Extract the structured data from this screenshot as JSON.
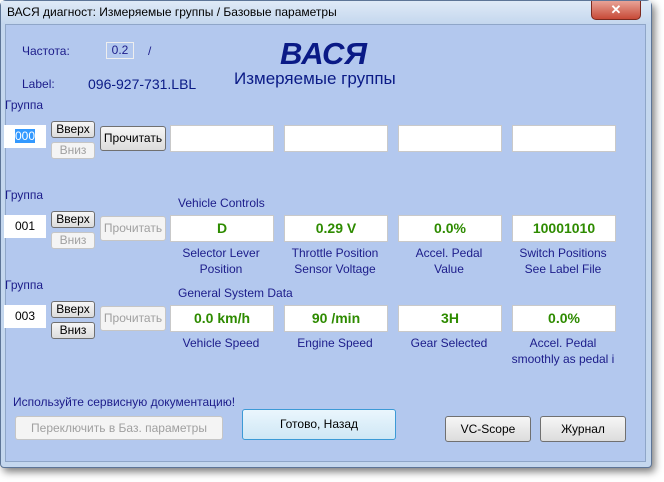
{
  "window": {
    "title": "ВАСЯ диагност: Измеряемые группы / Базовые параметры",
    "close_icon": "close-icon"
  },
  "header": {
    "freq_label": "Частота:",
    "freq_value": "0.2",
    "freq_sep": "/",
    "label_label": "Label:",
    "label_value": "096-927-731.LBL",
    "logo": "ВАСЯ",
    "subtitle": "Измеряемые группы"
  },
  "buttons": {
    "up": "Вверх",
    "down": "Вниз",
    "read": "Прочитать",
    "switch_basic": "Переключить в Баз. параметры",
    "done_back": "Готово, Назад",
    "vcscope": "VC-Scope",
    "journal": "Журнал"
  },
  "groups": [
    {
      "label": "Группа",
      "number": "000",
      "title": "",
      "values": [
        "",
        "",
        "",
        ""
      ],
      "captions": [
        "",
        "",
        "",
        ""
      ]
    },
    {
      "label": "Группа",
      "number": "001",
      "title": "Vehicle Controls",
      "values": [
        "D",
        "0.29 V",
        "0.0%",
        "10001010"
      ],
      "captions": [
        [
          "Selector Lever",
          "Position"
        ],
        [
          "Throttle Position",
          "Sensor Voltage"
        ],
        [
          "Accel. Pedal",
          "Value"
        ],
        [
          "Switch Positions",
          "See Label File"
        ]
      ]
    },
    {
      "label": "Группа",
      "number": "003",
      "title": "General System Data",
      "values": [
        "0.0 km/h",
        "90 /min",
        "3H",
        "0.0%"
      ],
      "captions": [
        [
          "Vehicle Speed",
          ""
        ],
        [
          "Engine Speed",
          ""
        ],
        [
          "Gear Selected",
          ""
        ],
        [
          "Accel. Pedal",
          "smoothly as pedal i"
        ]
      ]
    }
  ],
  "footer": {
    "notice": "Используйте сервисную документацию!"
  }
}
